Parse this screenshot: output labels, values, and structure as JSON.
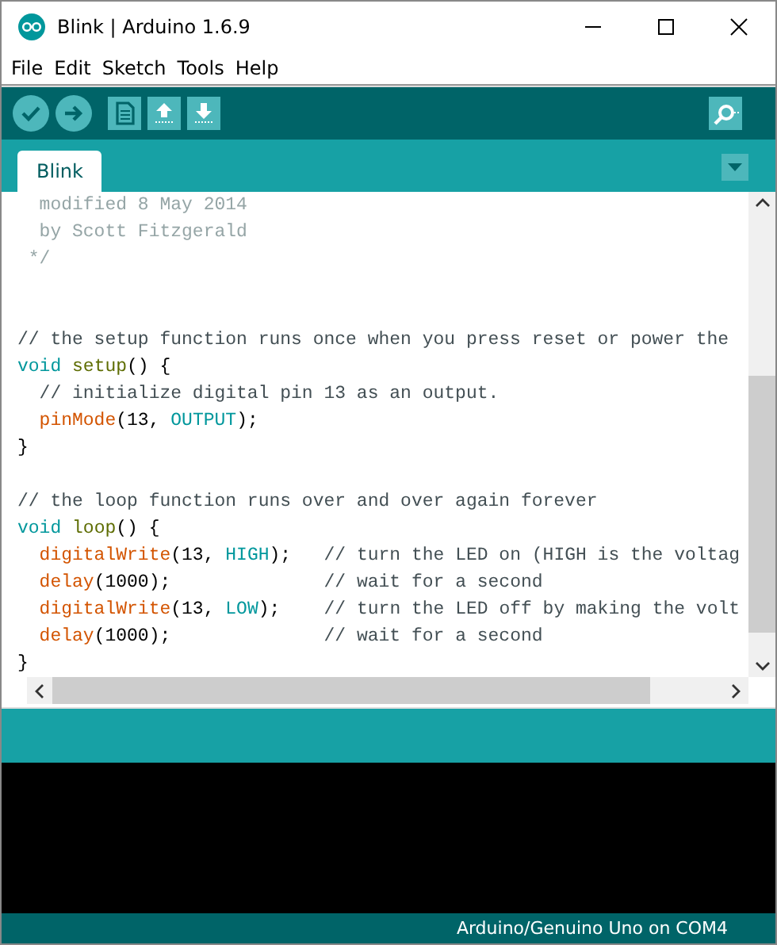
{
  "window": {
    "title": "Blink | Arduino 1.6.9"
  },
  "menu": [
    "File",
    "Edit",
    "Sketch",
    "Tools",
    "Help"
  ],
  "tabs": [
    {
      "label": "Blink",
      "selected": true
    }
  ],
  "editor": {
    "lines": [
      {
        "kind": "code",
        "tokens": [
          {
            "kind": "doc",
            "text": "  modified 8 May 2014"
          }
        ]
      },
      {
        "kind": "code",
        "tokens": [
          {
            "kind": "doc",
            "text": "  by Scott Fitzgerald"
          }
        ]
      },
      {
        "kind": "code",
        "tokens": [
          {
            "kind": "doc",
            "text": " */"
          }
        ]
      },
      {
        "kind": "blank"
      },
      {
        "kind": "blank"
      },
      {
        "kind": "code",
        "tokens": [
          {
            "kind": "comment",
            "text": "// the setup function runs once when you press reset or power the"
          }
        ]
      },
      {
        "kind": "code",
        "tokens": [
          {
            "kind": "keyword",
            "text": "void "
          },
          {
            "kind": "name",
            "text": "setup"
          },
          {
            "kind": "plain",
            "text": "() {"
          }
        ]
      },
      {
        "kind": "code",
        "tokens": [
          {
            "kind": "comment",
            "text": "  // initialize digital pin 13 as an output."
          }
        ]
      },
      {
        "kind": "code",
        "tokens": [
          {
            "kind": "function",
            "text": "  pinMode"
          },
          {
            "kind": "plain",
            "text": "(13, "
          },
          {
            "kind": "keyword",
            "text": "OUTPUT"
          },
          {
            "kind": "plain",
            "text": ");"
          }
        ]
      },
      {
        "kind": "code",
        "tokens": [
          {
            "kind": "plain",
            "text": "}"
          }
        ]
      },
      {
        "kind": "blank"
      },
      {
        "kind": "code",
        "tokens": [
          {
            "kind": "comment",
            "text": "// the loop function runs over and over again forever"
          }
        ]
      },
      {
        "kind": "code",
        "tokens": [
          {
            "kind": "keyword",
            "text": "void "
          },
          {
            "kind": "name",
            "text": "loop"
          },
          {
            "kind": "plain",
            "text": "() {"
          }
        ]
      },
      {
        "kind": "code",
        "tokens": [
          {
            "kind": "function",
            "text": "  digitalWrite"
          },
          {
            "kind": "plain",
            "text": "(13, "
          },
          {
            "kind": "keyword",
            "text": "HIGH"
          },
          {
            "kind": "plain",
            "text": ");   "
          },
          {
            "kind": "comment",
            "text": "// turn the LED on (HIGH is the voltag"
          }
        ]
      },
      {
        "kind": "code",
        "tokens": [
          {
            "kind": "function",
            "text": "  delay"
          },
          {
            "kind": "plain",
            "text": "(1000);              "
          },
          {
            "kind": "comment",
            "text": "// wait for a second"
          }
        ]
      },
      {
        "kind": "code",
        "tokens": [
          {
            "kind": "function",
            "text": "  digitalWrite"
          },
          {
            "kind": "plain",
            "text": "(13, "
          },
          {
            "kind": "keyword",
            "text": "LOW"
          },
          {
            "kind": "plain",
            "text": ");    "
          },
          {
            "kind": "comment",
            "text": "// turn the LED off by making the volt"
          }
        ]
      },
      {
        "kind": "code",
        "tokens": [
          {
            "kind": "function",
            "text": "  delay"
          },
          {
            "kind": "plain",
            "text": "(1000);              "
          },
          {
            "kind": "comment",
            "text": "// wait for a second"
          }
        ]
      },
      {
        "kind": "code",
        "tokens": [
          {
            "kind": "plain",
            "text": "}"
          }
        ]
      }
    ]
  },
  "status_bar": {
    "board": "Arduino/Genuino Uno on COM4"
  }
}
